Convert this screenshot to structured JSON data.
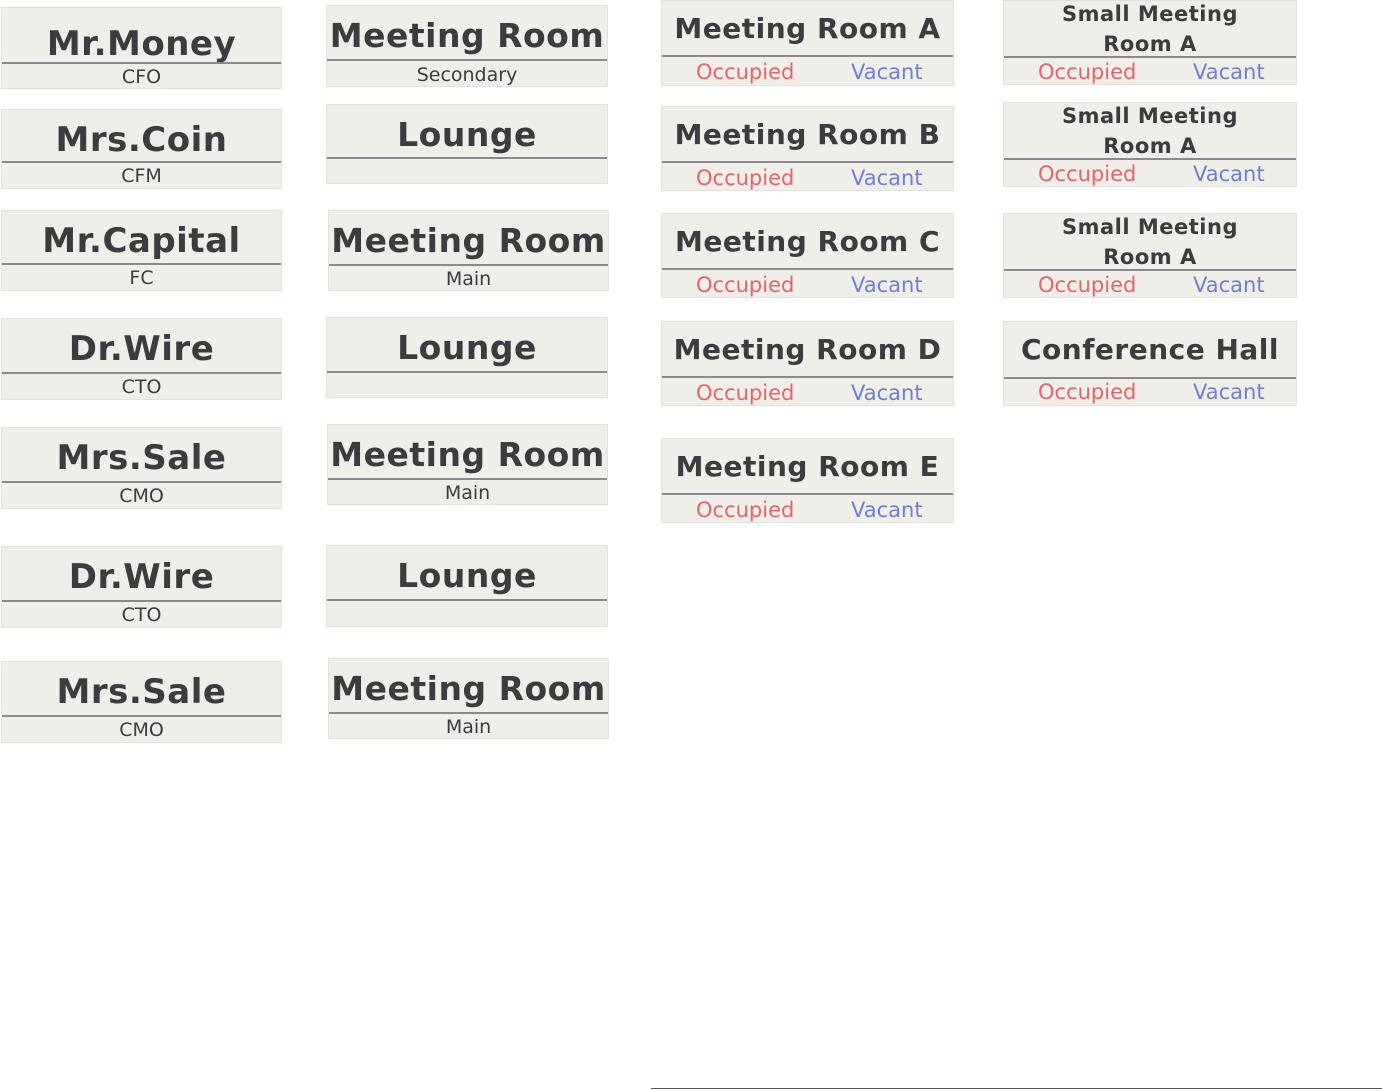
{
  "name_plates": [
    {
      "name": "Mr.Money",
      "title": "CFO"
    },
    {
      "name": "Mrs.Coin",
      "title": "CFM"
    },
    {
      "name": "Mr.Capital",
      "title": "FC"
    },
    {
      "name": "Dr.Wire",
      "title": "CTO"
    },
    {
      "name": "Mrs.Sale",
      "title": "CMO"
    },
    {
      "name": "Dr.Wire",
      "title": "CTO"
    },
    {
      "name": "Mrs.Sale",
      "title": "CMO"
    }
  ],
  "room_plates": [
    {
      "name": "Meeting Room",
      "label": "Secondary"
    },
    {
      "name": "Lounge",
      "label": ""
    },
    {
      "name": "Meeting Room",
      "label": "Main"
    },
    {
      "name": "Lounge",
      "label": ""
    },
    {
      "name": "Meeting Room",
      "label": "Main"
    },
    {
      "name": "Lounge",
      "label": ""
    },
    {
      "name": "Meeting Room",
      "label": "Main"
    }
  ],
  "status_labels": {
    "occupied": "Occupied",
    "vacant": "Vacant"
  },
  "meeting_rooms": [
    {
      "name": "Meeting Room A"
    },
    {
      "name": "Meeting Room B"
    },
    {
      "name": "Meeting Room C"
    },
    {
      "name": "Meeting Room D"
    },
    {
      "name": "Meeting Room E"
    }
  ],
  "small_rooms": [
    {
      "line1": "Small Meeting",
      "line2": "Room A"
    },
    {
      "line1": "Small Meeting",
      "line2": "Room A"
    },
    {
      "line1": "Small Meeting",
      "line2": "Room A"
    },
    {
      "line1": "Conference Hall",
      "line2": ""
    }
  ],
  "colors": {
    "occupied": "#e8646a",
    "vacant": "#6f7fd6",
    "plate": "#efeee8",
    "text": "#3c3c40"
  }
}
